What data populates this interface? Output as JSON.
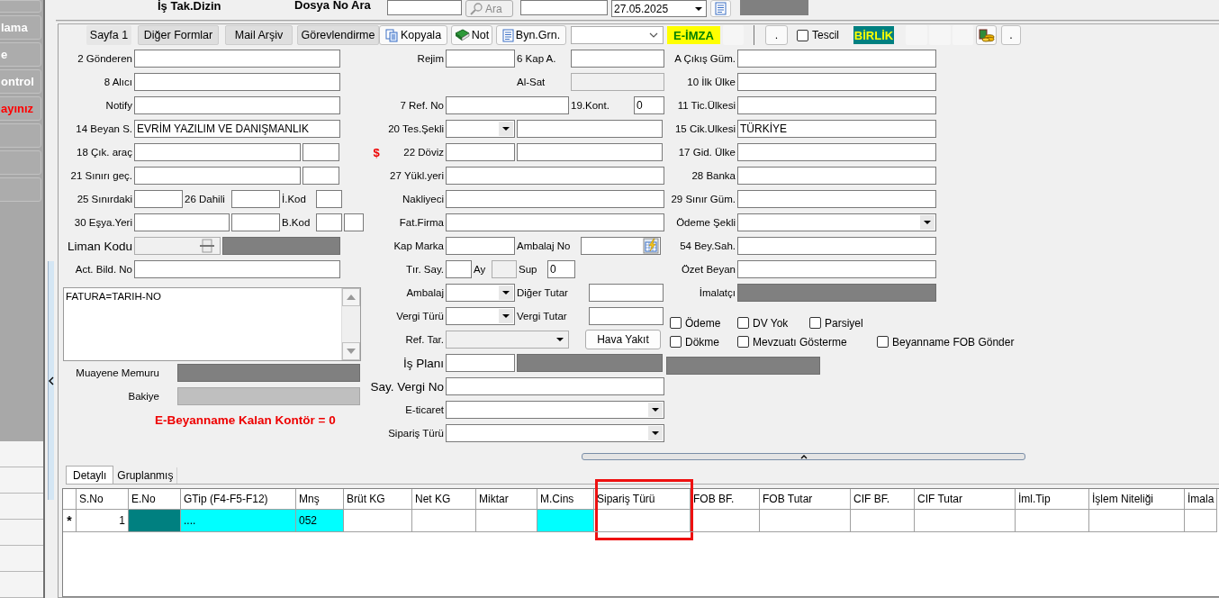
{
  "sidebar": {
    "items": [
      {
        "kind": "blank"
      },
      {
        "kind": "button",
        "label": "lama",
        "color": "#ffffff"
      },
      {
        "kind": "button",
        "label": "e",
        "color": "#ffffff"
      },
      {
        "kind": "button",
        "label": "ontrol",
        "color": "#ffffff"
      },
      {
        "kind": "button",
        "label": "ayınız",
        "color": "#ff0000"
      },
      {
        "kind": "blank"
      },
      {
        "kind": "blank"
      },
      {
        "kind": "blank"
      }
    ]
  },
  "header": {
    "title": "İş Tak.Dizin",
    "file_label": "Dosya No Ara",
    "search_button": {
      "label": "Ara",
      "disabled": true
    },
    "date": "27.05.2025"
  },
  "toolbar": [
    {
      "kind": "tab",
      "label": "Sayfa 1",
      "selected": true
    },
    {
      "kind": "tab",
      "label": "Diğer Formlar",
      "selected": false
    },
    {
      "kind": "tab",
      "label": "Mail Arşiv",
      "selected": false
    },
    {
      "kind": "tab",
      "label": "Görevlendirme",
      "selected": false
    },
    {
      "kind": "button",
      "label": "Kopyala"
    },
    {
      "kind": "button",
      "label": "Not"
    },
    {
      "kind": "button",
      "label": "Byn.Grn."
    },
    {
      "kind": "combo"
    },
    {
      "kind": "badge",
      "label": "E-İMZA",
      "color": "#ffff00"
    },
    {
      "kind": "blank"
    },
    {
      "kind": "separator"
    },
    {
      "kind": "button",
      "label": "."
    },
    {
      "kind": "checkbox",
      "label": "Tescil",
      "checked": false
    },
    {
      "kind": "badge",
      "label": "BİRLİK",
      "color": "#008080"
    },
    {
      "kind": "blank"
    },
    {
      "kind": "blank"
    },
    {
      "kind": "blank"
    },
    {
      "kind": "icon-button"
    },
    {
      "kind": "button",
      "label": "."
    }
  ],
  "form": {
    "left": {
      "rows": [
        [
          {
            "kind": "label",
            "text": "2 Gönderen"
          },
          {
            "kind": "input"
          }
        ],
        [
          {
            "kind": "label",
            "text": "8 Alıcı"
          },
          {
            "kind": "input"
          }
        ],
        [
          {
            "kind": "label",
            "text": "Notify"
          },
          {
            "kind": "input"
          }
        ],
        [
          {
            "kind": "label",
            "text": "14 Beyan S."
          },
          {
            "kind": "input",
            "value": "EVRİM YAZILIM VE DANIŞMANLIK"
          }
        ],
        [
          {
            "kind": "label",
            "text": "18 Çık. araç"
          },
          {
            "kind": "input"
          },
          {
            "kind": "input"
          }
        ],
        [
          {
            "kind": "label",
            "text": "21 Sınırı geç."
          },
          {
            "kind": "input"
          },
          {
            "kind": "input"
          }
        ],
        [
          {
            "kind": "label",
            "text": "25 Sınırdaki"
          },
          {
            "kind": "input"
          },
          {
            "kind": "label",
            "text": "26 Dahili"
          },
          {
            "kind": "input"
          },
          {
            "kind": "label",
            "text": "İ.Kod"
          },
          {
            "kind": "input"
          }
        ],
        [
          {
            "kind": "label",
            "text": "30 Eşya.Yeri"
          },
          {
            "kind": "input"
          },
          {
            "kind": "input"
          },
          {
            "kind": "label",
            "text": "B.Kod"
          },
          {
            "kind": "input"
          },
          {
            "kind": "input"
          }
        ],
        [
          {
            "kind": "biglabel",
            "text": "Liman Kodu"
          },
          {
            "kind": "lookup"
          },
          {
            "kind": "dark"
          }
        ],
        [
          {
            "kind": "label",
            "text": "Act. Bild. No"
          },
          {
            "kind": "input"
          }
        ]
      ],
      "notes": "FATURA=TARIH-NO",
      "officer_label": "Muayene Memuru",
      "balance_label": "Bakiye",
      "credit_notice": "E-Beyanname Kalan Kontör = 0"
    },
    "middle": {
      "rows": [
        [
          {
            "kind": "label",
            "text": "Rejim"
          },
          {
            "kind": "input"
          },
          {
            "kind": "label",
            "text": "6 Kap A."
          },
          {
            "kind": "input"
          }
        ],
        [
          {
            "kind": "spacer"
          },
          {
            "kind": "spacer"
          },
          {
            "kind": "label",
            "text": "Al-Sat"
          },
          {
            "kind": "disabled"
          }
        ],
        [
          {
            "kind": "label",
            "text": "7 Ref. No"
          },
          {
            "kind": "input"
          },
          {
            "kind": "label",
            "text": "19.Kont."
          },
          {
            "kind": "input",
            "value": "0"
          }
        ],
        [
          {
            "kind": "label",
            "text": "20 Tes.Şekli"
          },
          {
            "kind": "combo"
          },
          {
            "kind": "input"
          }
        ],
        [
          {
            "kind": "mark",
            "text": "$"
          },
          {
            "kind": "label",
            "text": "22 Döviz"
          },
          {
            "kind": "input"
          },
          {
            "kind": "input"
          }
        ],
        [
          {
            "kind": "label",
            "text": "27 Yükl.yeri"
          },
          {
            "kind": "input"
          }
        ],
        [
          {
            "kind": "label",
            "text": "Nakliyeci"
          },
          {
            "kind": "input"
          }
        ],
        [
          {
            "kind": "label",
            "text": "Fat.Firma"
          },
          {
            "kind": "input"
          }
        ],
        [
          {
            "kind": "label",
            "text": "Kap Marka"
          },
          {
            "kind": "input"
          },
          {
            "kind": "label",
            "text": "Ambalaj No"
          },
          {
            "kind": "picker"
          }
        ],
        [
          {
            "kind": "label",
            "text": "Tır. Say."
          },
          {
            "kind": "input"
          },
          {
            "kind": "label",
            "text": "Ay"
          },
          {
            "kind": "disabled"
          },
          {
            "kind": "label",
            "text": "Sup"
          },
          {
            "kind": "input",
            "value": "0"
          }
        ],
        [
          {
            "kind": "label",
            "text": "Ambalaj"
          },
          {
            "kind": "combo"
          },
          {
            "kind": "label",
            "text": "Diğer Tutar"
          },
          {
            "kind": "input"
          }
        ],
        [
          {
            "kind": "label",
            "text": "Vergi Türü"
          },
          {
            "kind": "combo"
          },
          {
            "kind": "label",
            "text": "Vergi Tutar"
          },
          {
            "kind": "input"
          }
        ],
        [
          {
            "kind": "label",
            "text": "Ref. Tar."
          },
          {
            "kind": "disabled-combo"
          },
          {
            "kind": "button",
            "text": "Hava Yakıt"
          }
        ],
        [
          {
            "kind": "biglabel",
            "text": "İş Planı"
          },
          {
            "kind": "input"
          },
          {
            "kind": "dark"
          }
        ],
        [
          {
            "kind": "biglabel",
            "text": "Say. Vergi No"
          },
          {
            "kind": "input"
          }
        ],
        [
          {
            "kind": "label",
            "text": "E-ticaret"
          },
          {
            "kind": "combo"
          }
        ],
        [
          {
            "kind": "label",
            "text": "Sipariş Türü"
          },
          {
            "kind": "combo"
          }
        ]
      ]
    },
    "right": {
      "rows": [
        [
          {
            "kind": "label",
            "text": "A Çıkış Güm."
          },
          {
            "kind": "input"
          }
        ],
        [
          {
            "kind": "label",
            "text": "10 İlk Ülke"
          },
          {
            "kind": "input"
          }
        ],
        [
          {
            "kind": "label",
            "text": "11 Tic.Ülkesi"
          },
          {
            "kind": "input"
          }
        ],
        [
          {
            "kind": "label",
            "text": "15 Cik.Ulkesi"
          },
          {
            "kind": "input",
            "value": "TÜRKİYE"
          }
        ],
        [
          {
            "kind": "label",
            "text": "17 Gid. Ülke"
          },
          {
            "kind": "input"
          }
        ],
        [
          {
            "kind": "label",
            "text": "28 Banka"
          },
          {
            "kind": "input"
          }
        ],
        [
          {
            "kind": "label",
            "text": "29 Sınır Güm."
          },
          {
            "kind": "input"
          }
        ],
        [
          {
            "kind": "label",
            "text": "Ödeme Şekli"
          },
          {
            "kind": "combo"
          }
        ],
        [
          {
            "kind": "label",
            "text": "54 Bey.Sah."
          },
          {
            "kind": "input"
          }
        ],
        [
          {
            "kind": "label",
            "text": "Özet Beyan"
          },
          {
            "kind": "input"
          }
        ],
        [
          {
            "kind": "label",
            "text": "İmalatçı"
          },
          {
            "kind": "dark"
          }
        ]
      ],
      "options": [
        [
          {
            "label": "Ödeme",
            "checked": false
          },
          {
            "label": "DV Yok",
            "checked": false
          },
          {
            "label": "Parsiyel",
            "checked": false
          }
        ],
        [
          {
            "label": "Dökme",
            "checked": false
          },
          {
            "label": "Mevzuatı Gösterme",
            "checked": false
          },
          {
            "label": "Beyanname FOB Gönder",
            "checked": false
          }
        ]
      ]
    }
  },
  "detail_tabs": [
    {
      "label": "Detaylı",
      "selected": true
    },
    {
      "label": "Gruplanmış",
      "selected": false
    }
  ],
  "grid": {
    "columns": [
      {
        "label": "S.No",
        "highlighted": false
      },
      {
        "label": "E.No",
        "highlighted": false
      },
      {
        "label": "GTip (F4-F5-F12)",
        "highlighted": false
      },
      {
        "label": "Mnş",
        "highlighted": false
      },
      {
        "label": "Brüt KG",
        "highlighted": false
      },
      {
        "label": "Net KG",
        "highlighted": false
      },
      {
        "label": "Miktar",
        "highlighted": false
      },
      {
        "label": "M.Cins",
        "highlighted": false
      },
      {
        "label": "Sipariş Türü",
        "highlighted": true
      },
      {
        "label": "FOB BF.",
        "highlighted": false
      },
      {
        "label": "FOB Tutar",
        "highlighted": false
      },
      {
        "label": "CIF BF.",
        "highlighted": false
      },
      {
        "label": "CIF Tutar",
        "highlighted": false
      },
      {
        "label": "İml.Tip",
        "highlighted": false
      },
      {
        "label": "İşlem Niteliği",
        "highlighted": false
      },
      {
        "label": "İmala",
        "highlighted": false
      }
    ],
    "rows": [
      {
        "indicator": "*",
        "cells": [
          {
            "text": "1"
          },
          {
            "color": "#008080"
          },
          {
            "text": "....",
            "color": "#00ffff"
          },
          {
            "text": "052",
            "color": "#00ffff"
          },
          {},
          {},
          {},
          {
            "color": "#00ffff"
          },
          {},
          {},
          {},
          {},
          {},
          {},
          {},
          {}
        ]
      }
    ]
  }
}
